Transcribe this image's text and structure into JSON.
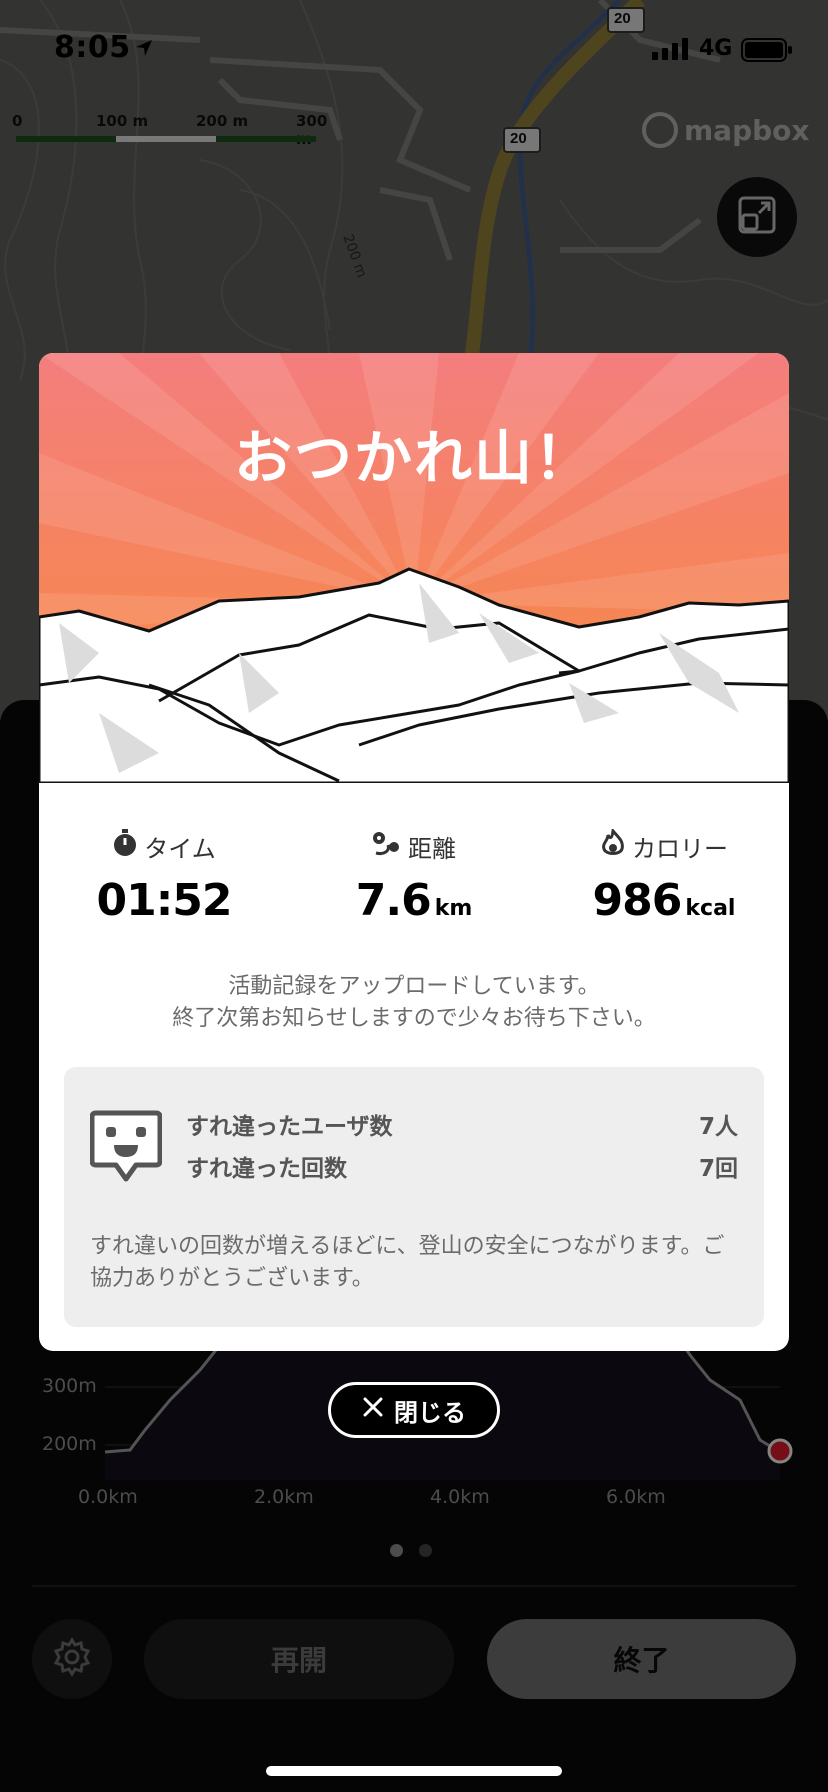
{
  "status_bar": {
    "time": "8:05",
    "network": "4G"
  },
  "map": {
    "scale_labels": [
      "0",
      "100 m",
      "200 m",
      "300 m"
    ],
    "road_badge_1": "20",
    "road_badge_2": "20",
    "contour_label": "200 m",
    "attribution": "mapbox"
  },
  "modal": {
    "title": "おつかれ山！",
    "stats": [
      {
        "label": "タイム",
        "value": "01:52",
        "unit": ""
      },
      {
        "label": "距離",
        "value": "7.6",
        "unit": "km"
      },
      {
        "label": "カロリー",
        "value": "986",
        "unit": "kcal"
      }
    ],
    "upload_line1": "活動記録をアップロードしています。",
    "upload_line2": "終了次第お知らせしますので少々お待ち下さい。",
    "pass": {
      "users_label": "すれ違ったユーザ数",
      "users_value": "7人",
      "count_label": "すれ違った回数",
      "count_value": "7回",
      "note": "すれ違いの回数が増えるほどに、登山の安全につながります。ご協力ありがとうございます。"
    },
    "close_label": "閉じる"
  },
  "elevation": {
    "y_labels": [
      "300m",
      "200m"
    ],
    "x_labels": [
      "0.0km",
      "2.0km",
      "4.0km",
      "6.0km"
    ]
  },
  "controls": {
    "resume_label": "再開",
    "end_label": "終了"
  },
  "colors": {
    "hero_top": "#f47e7e",
    "hero_bottom": "#f78a3b",
    "accent_red": "#d81b2c"
  }
}
